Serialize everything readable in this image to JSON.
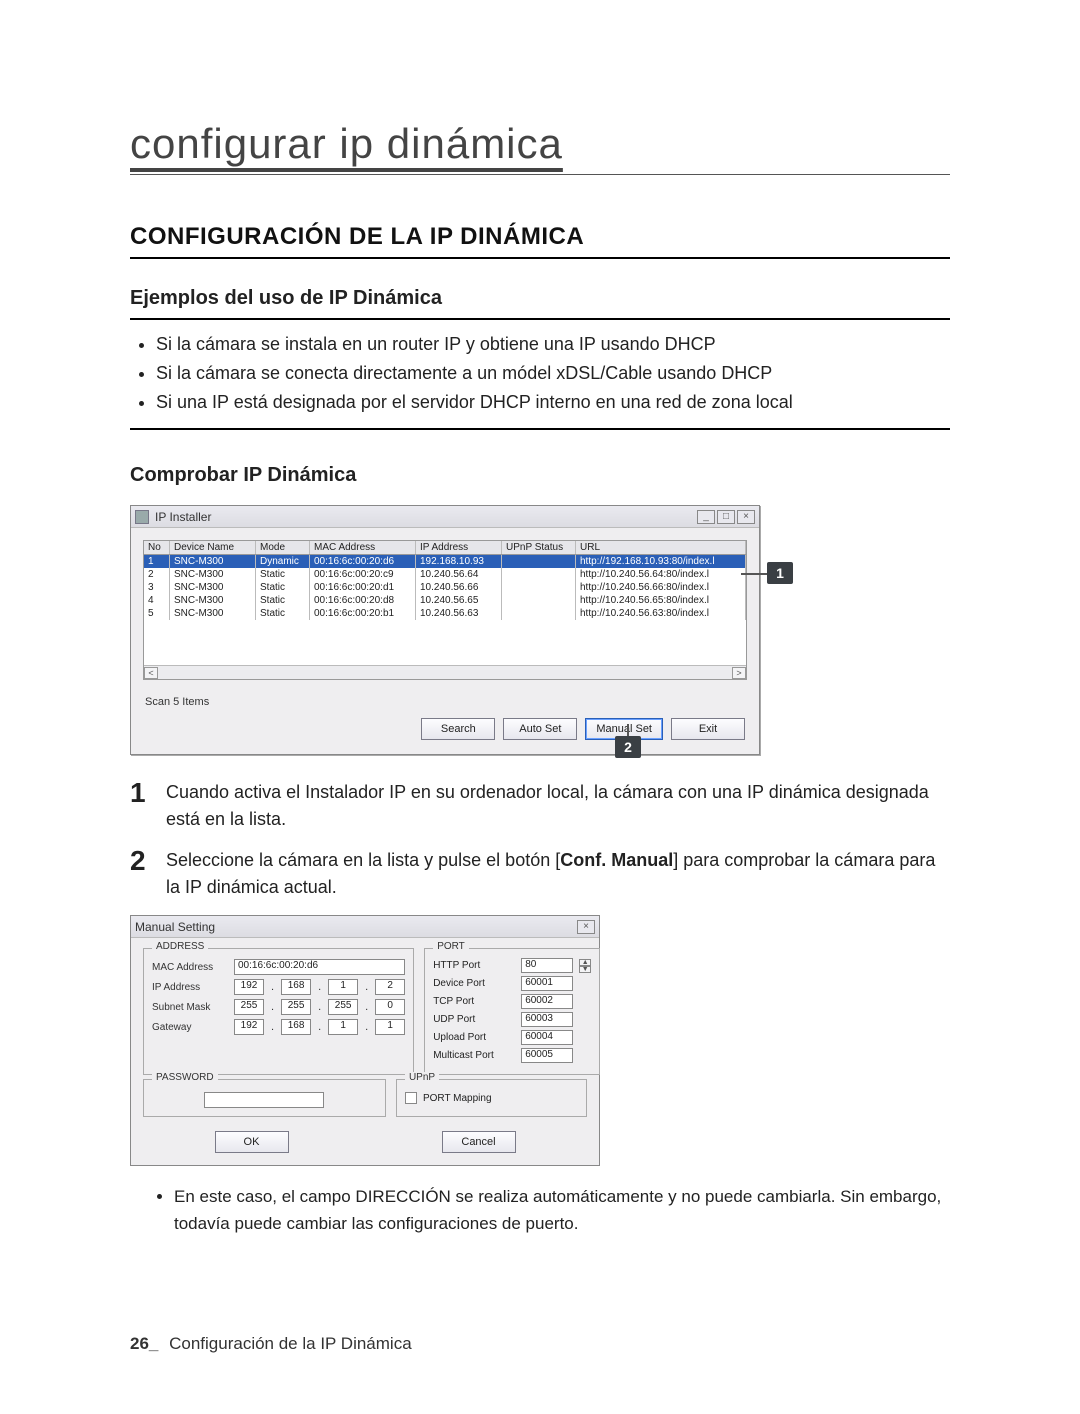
{
  "page": {
    "banner": "configurar ip dinámica",
    "heading": "CONFIGURACIÓN DE LA IP DINÁMICA",
    "sub1": "Ejemplos del uso de IP Dinámica",
    "bullets1": [
      "Si la cámara se instala en un router IP y obtiene una IP usando DHCP",
      "Si la cámara se conecta directamente a un módel xDSL/Cable usando DHCP",
      "Si una IP está designada por el servidor DHCP interno en una red de zona local"
    ],
    "sub2": "Comprobar IP Dinámica"
  },
  "ip_installer": {
    "title": "IP Installer",
    "win_min": "_",
    "win_max": "□",
    "win_close": "×",
    "columns": {
      "no": "No",
      "device": "Device Name",
      "mode": "Mode",
      "mac": "MAC Address",
      "ip": "IP Address",
      "upnp": "UPnP Status",
      "url": "URL"
    },
    "rows": [
      {
        "no": "1",
        "device": "SNC-M300",
        "mode": "Dynamic",
        "mac": "00:16:6c:00:20:d6",
        "ip": "192.168.10.93",
        "upnp": "",
        "url": "http://192.168.10.93:80/index.l"
      },
      {
        "no": "2",
        "device": "SNC-M300",
        "mode": "Static",
        "mac": "00:16:6c:00:20:c9",
        "ip": "10.240.56.64",
        "upnp": "",
        "url": "http://10.240.56.64:80/index.l"
      },
      {
        "no": "3",
        "device": "SNC-M300",
        "mode": "Static",
        "mac": "00:16:6c:00:20:d1",
        "ip": "10.240.56.66",
        "upnp": "",
        "url": "http://10.240.56.66:80/index.l"
      },
      {
        "no": "4",
        "device": "SNC-M300",
        "mode": "Static",
        "mac": "00:16:6c:00:20:d8",
        "ip": "10.240.56.65",
        "upnp": "",
        "url": "http://10.240.56.65:80/index.l"
      },
      {
        "no": "5",
        "device": "SNC-M300",
        "mode": "Static",
        "mac": "00:16:6c:00:20:b1",
        "ip": "10.240.56.63",
        "upnp": "",
        "url": "http://10.240.56.63:80/index.l"
      }
    ],
    "scroll_left": "<",
    "scroll_right": ">",
    "scan": "Scan 5 Items",
    "btn_search": "Search",
    "btn_auto": "Auto Set",
    "btn_manual": "Manual Set",
    "btn_exit": "Exit",
    "callout1": "1",
    "callout2": "2"
  },
  "steps": {
    "s1_num": "1",
    "s1_text": "Cuando activa el Instalador IP en su ordenador local, la cámara con una IP dinámica designada está en la lista.",
    "s2_num": "2",
    "s2_text_a": "Seleccione la cámara en la lista y pulse el botón [",
    "s2_bold": "Conf. Manual",
    "s2_text_b": "] para comprobar la cámara para la IP dinámica actual."
  },
  "manual": {
    "title": "Manual Setting",
    "close": "×",
    "addr_group": "ADDRESS",
    "mac_label": "MAC Address",
    "mac_value": "00:16:6c:00:20:d6",
    "ip_label": "IP Address",
    "ip": [
      "192",
      "168",
      "1",
      "2"
    ],
    "sm_label": "Subnet Mask",
    "sm": [
      "255",
      "255",
      "255",
      "0"
    ],
    "gw_label": "Gateway",
    "gw": [
      "192",
      "168",
      "1",
      "1"
    ],
    "port_group": "PORT",
    "ports": [
      {
        "label": "HTTP Port",
        "value": "80"
      },
      {
        "label": "Device Port",
        "value": "60001"
      },
      {
        "label": "TCP Port",
        "value": "60002"
      },
      {
        "label": "UDP Port",
        "value": "60003"
      },
      {
        "label": "Upload Port",
        "value": "60004"
      },
      {
        "label": "Multicast Port",
        "value": "60005"
      }
    ],
    "pwd_group": "PASSWORD",
    "upnp_group": "UPnP",
    "upnp_check": "PORT Mapping",
    "ok": "OK",
    "cancel": "Cancel"
  },
  "note": [
    "En este caso, el campo DIRECCIÓN se realiza automáticamente y no puede cambiarla. Sin embargo, todavía puede cambiar las configuraciones de puerto."
  ],
  "footer": {
    "page": "26_",
    "text": "Configuración de la IP Dinámica"
  }
}
